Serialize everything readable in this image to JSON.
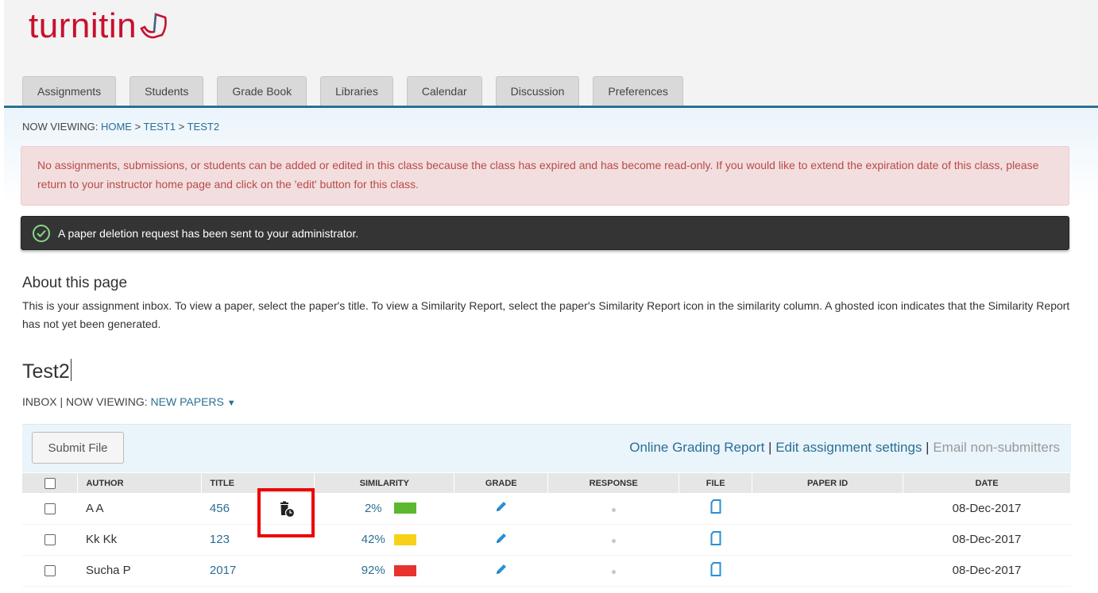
{
  "brand": {
    "name": "turnitin"
  },
  "tabs": [
    "Assignments",
    "Students",
    "Grade Book",
    "Libraries",
    "Calendar",
    "Discussion",
    "Preferences"
  ],
  "breadcrumb": {
    "prefix": "NOW VIEWING: ",
    "home": "HOME",
    "sep1": " > ",
    "test1": "TEST1",
    "sep2": " > ",
    "test2": "TEST2"
  },
  "alerts": {
    "expired": "No assignments, submissions, or students can be added or edited in this class because the class has expired and has become read-only. If you would like to extend the expiration date of this class, please return to your instructor home page and click on the 'edit' button for this class.",
    "success": "A paper deletion request has been sent to your administrator."
  },
  "about": {
    "title": "About this page",
    "text": "This is your assignment inbox. To view a paper, select the paper's title. To view a Similarity Report, select the paper's Similarity Report icon in the similarity column. A ghosted icon indicates that the Similarity Report has not yet been generated."
  },
  "page": {
    "title": "Test2",
    "inbox_label": "INBOX  |  NOW VIEWING: ",
    "viewing": "NEW PAPERS",
    "viewing_caret": "▼"
  },
  "toolbar": {
    "submit_label": "Submit File",
    "online_grading": "Online Grading Report",
    "sep1": " | ",
    "edit_settings": "Edit assignment settings",
    "sep2": " | ",
    "email": "Email non-submitters"
  },
  "table": {
    "headers": {
      "author": "AUTHOR",
      "title": "TITLE",
      "similarity": "SIMILARITY",
      "grade": "GRADE",
      "response": "RESPONSE",
      "file": "FILE",
      "paper_id": "PAPER ID",
      "date": "DATE"
    },
    "rows": [
      {
        "author": "A A",
        "title": "456",
        "similarity": "2%",
        "sim_color": "#5cb82e",
        "paper_id": "",
        "date": "08-Dec-2017",
        "pending_delete": true
      },
      {
        "author": "Kk Kk",
        "title": "123",
        "similarity": "42%",
        "sim_color": "#f7d117",
        "paper_id": "",
        "date": "08-Dec-2017",
        "pending_delete": false
      },
      {
        "author": "Sucha P",
        "title": "2017",
        "similarity": "92%",
        "sim_color": "#e8322d",
        "paper_id": "",
        "date": "08-Dec-2017",
        "pending_delete": false
      }
    ]
  },
  "colors": {
    "brand_red": "#c8102e",
    "link_blue": "#2b6f93",
    "highlight": "#ee0000"
  }
}
